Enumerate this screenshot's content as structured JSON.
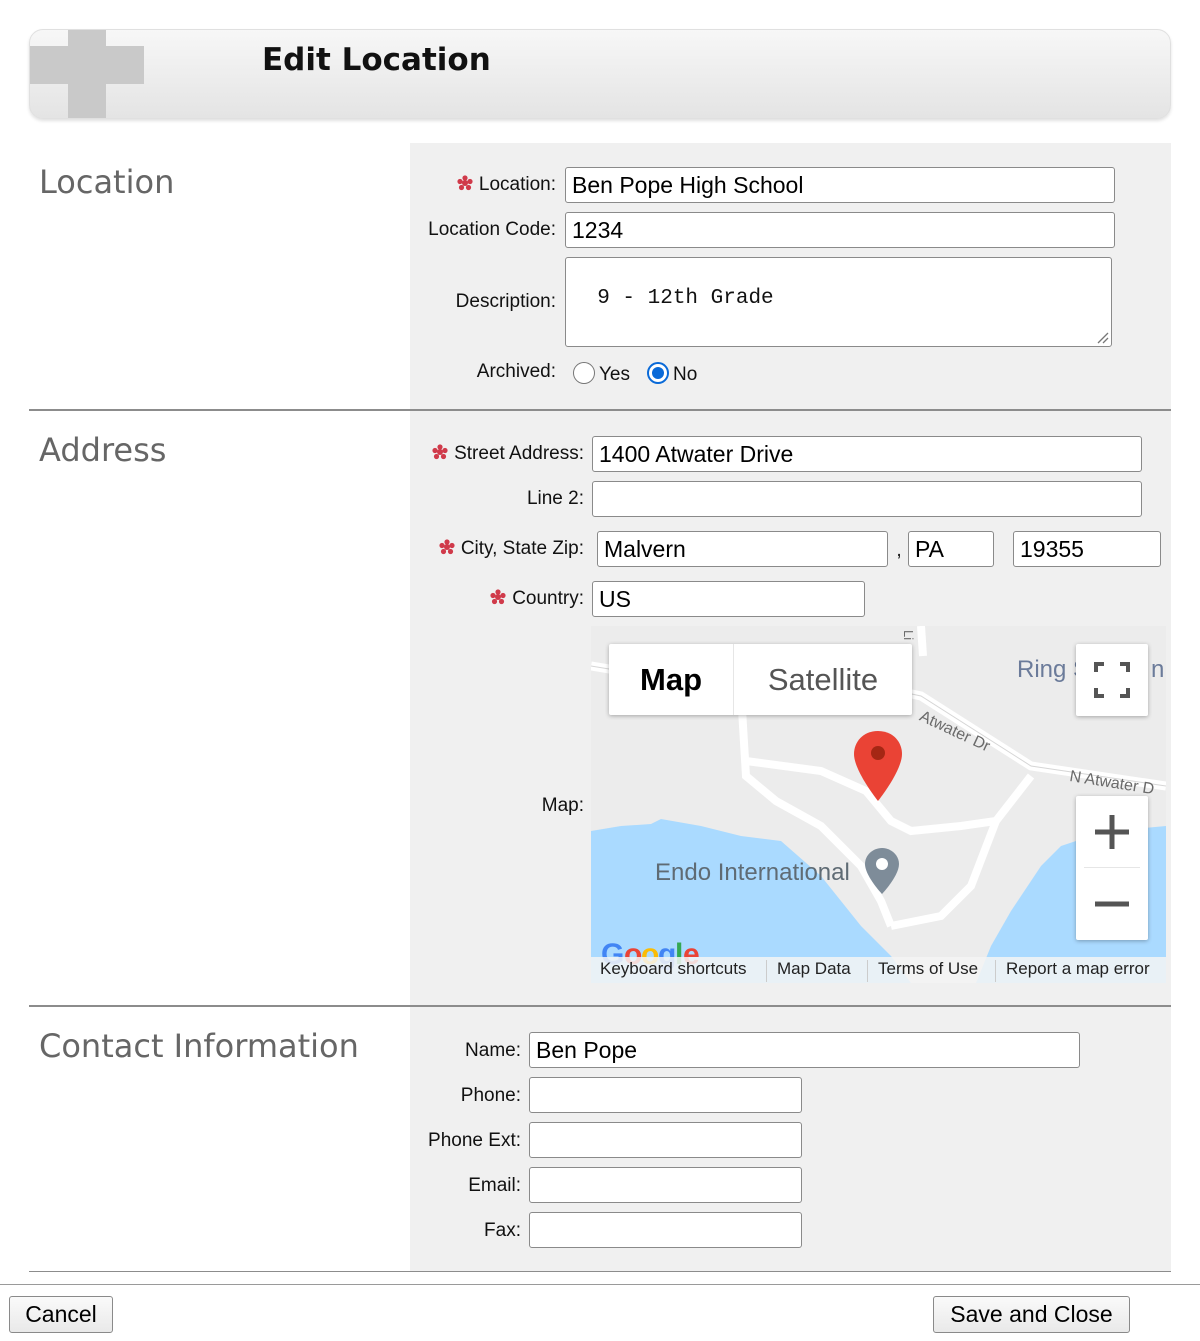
{
  "header": {
    "title": "Edit Location"
  },
  "sections": {
    "location": {
      "title": "Location",
      "location_label": "Location:",
      "location_value": "Ben Pope High School",
      "code_label": "Location Code:",
      "code_value": "1234",
      "description_label": "Description:",
      "description_value": "9 - 12th Grade",
      "archived_label": "Archived:",
      "archived_yes": "Yes",
      "archived_no": "No",
      "archived_selected": "No"
    },
    "address": {
      "title": "Address",
      "street_label": "Street Address:",
      "street_value": "1400 Atwater Drive",
      "line2_label": "Line 2:",
      "line2_value": "",
      "csz_label": "City, State Zip:",
      "city_value": "Malvern",
      "comma": ",",
      "state_value": "PA",
      "zip_value": "19355",
      "country_label": "Country:",
      "country_value": "US",
      "map_label": "Map:"
    },
    "contact": {
      "title": "Contact Information",
      "name_label": "Name:",
      "name_value": "Ben Pope",
      "phone_label": "Phone:",
      "phone_value": "",
      "ext_label": "Phone Ext:",
      "ext_value": "",
      "email_label": "Email:",
      "email_value": "",
      "fax_label": "Fax:",
      "fax_value": ""
    }
  },
  "map": {
    "type_map": "Map",
    "type_satellite": "Satellite",
    "place_label": "Endo International",
    "ring_label": "Ring S",
    "ring_label_tail": "n",
    "road_atwater": "Atwater Dr",
    "road_n_atwater": "N Atwater D",
    "road_top": "Li",
    "footer": {
      "shortcuts": "Keyboard shortcuts",
      "data": "Map Data",
      "terms": "Terms of Use",
      "report": "Report a map error"
    },
    "colors": {
      "water": "#aadaff",
      "land": "#ececec",
      "road": "#ffffff",
      "pin": "#ea4335"
    }
  },
  "buttons": {
    "cancel": "Cancel",
    "save_close": "Save and Close"
  },
  "colors": {
    "panel": "#f0f0f0",
    "section_title": "#666666",
    "required": "#d03a4a"
  }
}
